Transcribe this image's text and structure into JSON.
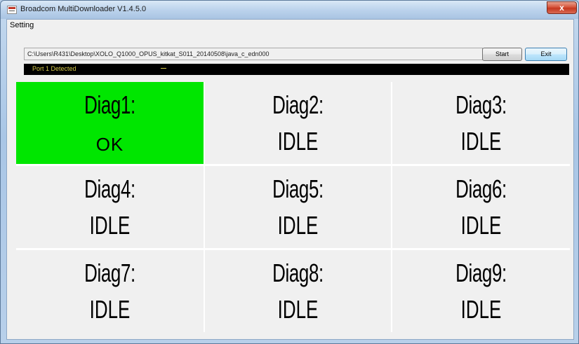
{
  "window": {
    "title": "Broadcom MultiDownloader V1.4.5.0",
    "close_glyph": "x"
  },
  "menu": {
    "items": [
      {
        "label": "Setting"
      }
    ]
  },
  "toolbar": {
    "path": "C:\\Users\\R431\\Desktop\\XOLO_Q1000_OPUS_kitkat_S011_20140508\\java_c_edn000",
    "start_label": "Start",
    "exit_label": "Exit"
  },
  "status": {
    "text": "Port 1 Detected",
    "text_color": "#d9cc4a",
    "background": "#000000"
  },
  "ports": [
    {
      "label": "Diag1:",
      "state": "OK",
      "color": "#00e600"
    },
    {
      "label": "Diag2:",
      "state": "IDLE",
      "color": "#f0f0f0"
    },
    {
      "label": "Diag3:",
      "state": "IDLE",
      "color": "#f0f0f0"
    },
    {
      "label": "Diag4:",
      "state": "IDLE",
      "color": "#f0f0f0"
    },
    {
      "label": "Diag5:",
      "state": "IDLE",
      "color": "#f0f0f0"
    },
    {
      "label": "Diag6:",
      "state": "IDLE",
      "color": "#f0f0f0"
    },
    {
      "label": "Diag7:",
      "state": "IDLE",
      "color": "#f0f0f0"
    },
    {
      "label": "Diag8:",
      "state": "IDLE",
      "color": "#f0f0f0"
    },
    {
      "label": "Diag9:",
      "state": "IDLE",
      "color": "#f0f0f0"
    }
  ]
}
